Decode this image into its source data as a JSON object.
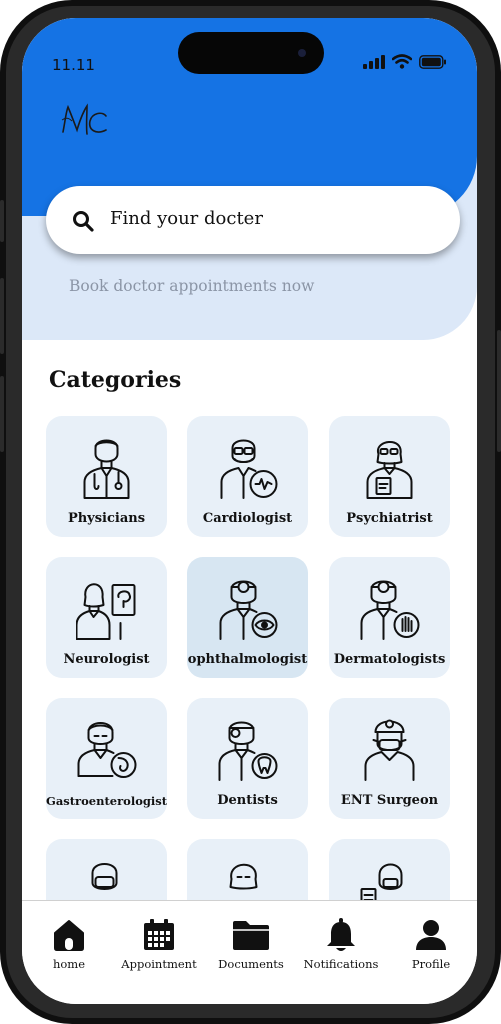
{
  "status_bar": {
    "time": "11.11"
  },
  "logo": {
    "text": "MC"
  },
  "search": {
    "placeholder": "Find your docter"
  },
  "hero": {
    "subtitle": "Book doctor appointments now"
  },
  "categories": {
    "title": "Categories",
    "items": [
      {
        "label": "Physicians",
        "icon": "physician-icon"
      },
      {
        "label": "Cardiologist",
        "icon": "cardiologist-icon"
      },
      {
        "label": "Psychiatrist",
        "icon": "psychiatrist-icon"
      },
      {
        "label": "Neurologist",
        "icon": "neurologist-icon"
      },
      {
        "label": "ophthalmologist",
        "icon": "ophthalmologist-icon",
        "selected": true
      },
      {
        "label": "Dermatologists",
        "icon": "dermatologist-icon"
      },
      {
        "label": "Gastroenterologist",
        "icon": "gastroenterologist-icon"
      },
      {
        "label": "Dentists",
        "icon": "dentist-icon"
      },
      {
        "label": "ENT Surgeon",
        "icon": "ent-surgeon-icon"
      }
    ]
  },
  "bottom_nav": {
    "items": [
      {
        "label": "home",
        "icon": "home-icon"
      },
      {
        "label": "Appointment",
        "icon": "calendar-icon"
      },
      {
        "label": "Documents",
        "icon": "folder-icon"
      },
      {
        "label": "Notifications",
        "icon": "bell-icon"
      },
      {
        "label": "Profile",
        "icon": "user-icon"
      }
    ]
  },
  "colors": {
    "primary": "#1573e4",
    "hero_light": "#dce8f8",
    "card": "#e8f0f8",
    "card_selected": "#d7e6f2"
  }
}
